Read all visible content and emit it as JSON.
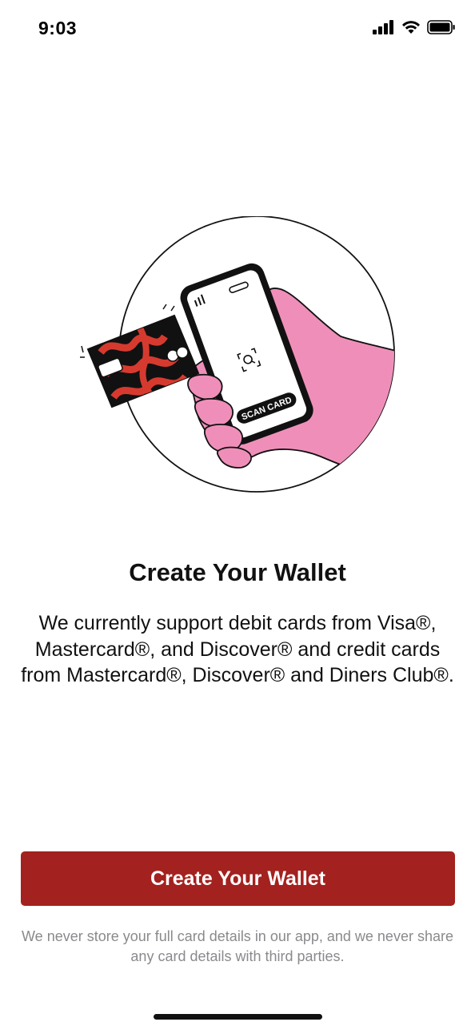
{
  "status_bar": {
    "time": "9:03",
    "icons": [
      "cellular-signal-icon",
      "wifi-icon",
      "battery-icon"
    ]
  },
  "illustration": {
    "description_icon": "hand-holding-phone-scanning-card-illustration",
    "scan_label": "SCAN CARD",
    "colors": {
      "hand": "#ef8fb9",
      "card_red": "#d63a2f",
      "card_black": "#111111"
    }
  },
  "title": "Create Your Wallet",
  "description": "We currently support debit cards from Visa®, Mastercard®, and Discover® and credit cards from Mastercard®, Discover® and Diners Club®.",
  "primary_button": {
    "label": "Create Your Wallet",
    "color": "#a3211e"
  },
  "disclaimer": "We never store your full card details in our app, and we never share any card details with third parties."
}
